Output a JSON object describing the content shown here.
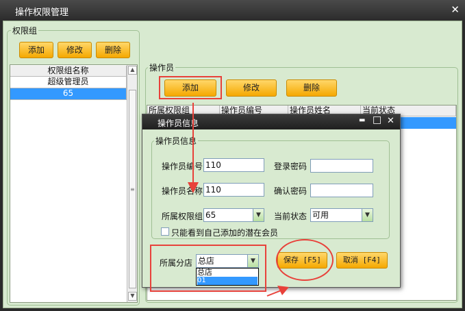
{
  "window": {
    "title": "操作权限管理",
    "close_glyph": "✕"
  },
  "left_group": {
    "title": "权限组",
    "buttons": {
      "add": "添加",
      "edit": "修改",
      "delete": "删除"
    },
    "header": "权限组名称",
    "rows": [
      "超级管理员",
      "65"
    ]
  },
  "right_group": {
    "title": "操作员",
    "buttons": {
      "add": "添加",
      "edit": "修改",
      "delete": "删除"
    },
    "columns": [
      "所属权限组",
      "操作员编号",
      "操作员姓名",
      "当前状态"
    ]
  },
  "dialog": {
    "title": "操作员信息",
    "controls": {
      "minimize": "▬",
      "maximize": "□",
      "close": "✕"
    },
    "group_title": "操作员信息",
    "fields": {
      "operator_id_label": "操作员编号",
      "operator_id_value": "110",
      "login_pwd_label": "登录密码",
      "login_pwd_value": "",
      "operator_name_label": "操作员名称",
      "operator_name_value": "110",
      "confirm_pwd_label": "确认密码",
      "confirm_pwd_value": "",
      "perm_group_label": "所属权限组",
      "perm_group_value": "65",
      "status_label": "当前状态",
      "status_value": "可用"
    },
    "checkbox_label": "只能看到自己添加的潜在会员",
    "branch_label": "所属分店",
    "branch_value": "总店",
    "branch_options": [
      "总店",
      "01"
    ],
    "save_label": "保存 [F5]",
    "cancel_label": "取消 [F4]"
  },
  "colors": {
    "accent": "#f5a800",
    "selection": "#3399ff",
    "annotation": "#e8413a",
    "panel": "#d8ead0"
  }
}
